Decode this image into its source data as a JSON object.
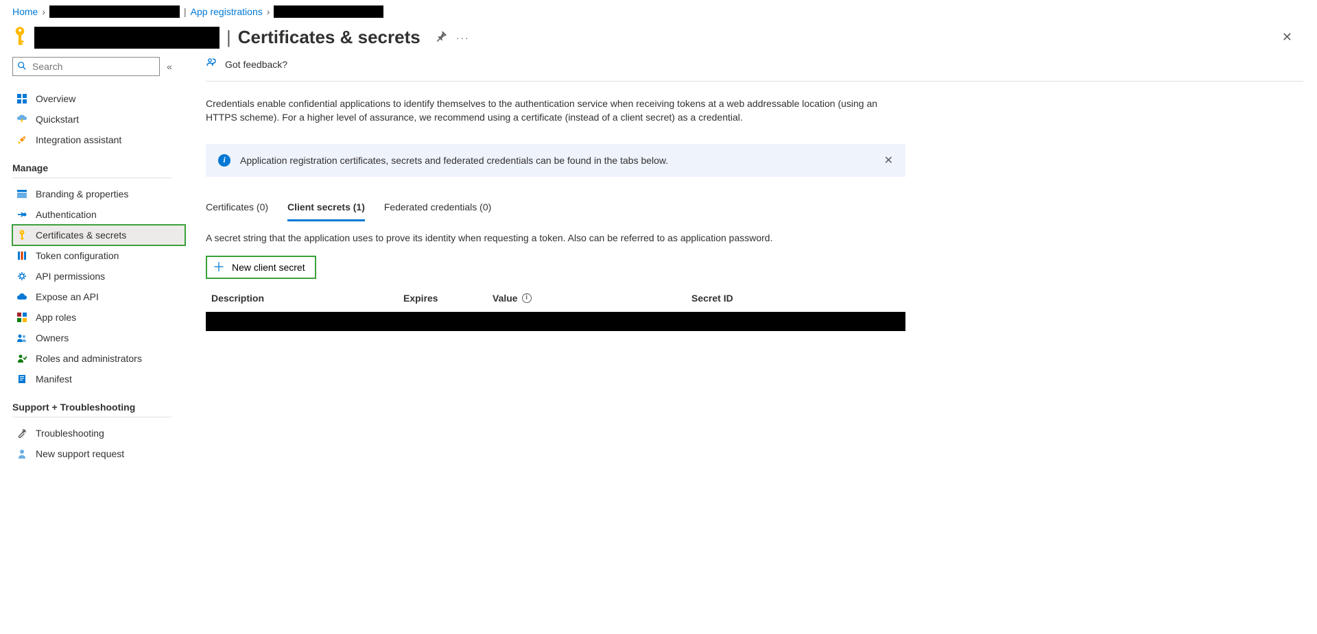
{
  "breadcrumb": {
    "home": "Home",
    "app_registrations": "App registrations"
  },
  "header": {
    "title_suffix": "Certificates & secrets"
  },
  "sidebar": {
    "search_placeholder": "Search",
    "sections": {
      "top": [
        {
          "label": "Overview"
        },
        {
          "label": "Quickstart"
        },
        {
          "label": "Integration assistant"
        }
      ],
      "manage_label": "Manage",
      "manage": [
        {
          "label": "Branding & properties"
        },
        {
          "label": "Authentication"
        },
        {
          "label": "Certificates & secrets"
        },
        {
          "label": "Token configuration"
        },
        {
          "label": "API permissions"
        },
        {
          "label": "Expose an API"
        },
        {
          "label": "App roles"
        },
        {
          "label": "Owners"
        },
        {
          "label": "Roles and administrators"
        },
        {
          "label": "Manifest"
        }
      ],
      "support_label": "Support + Troubleshooting",
      "support": [
        {
          "label": "Troubleshooting"
        },
        {
          "label": "New support request"
        }
      ]
    }
  },
  "main": {
    "feedback": "Got feedback?",
    "intro": "Credentials enable confidential applications to identify themselves to the authentication service when receiving tokens at a web addressable location (using an HTTPS scheme). For a higher level of assurance, we recommend using a certificate (instead of a client secret) as a credential.",
    "banner": "Application registration certificates, secrets and federated credentials can be found in the tabs below.",
    "tabs": [
      {
        "label": "Certificates (0)"
      },
      {
        "label": "Client secrets (1)"
      },
      {
        "label": "Federated credentials (0)"
      }
    ],
    "tab_desc": "A secret string that the application uses to prove its identity when requesting a token. Also can be referred to as application password.",
    "new_secret": "New client secret",
    "table": {
      "description": "Description",
      "expires": "Expires",
      "value": "Value",
      "secret_id": "Secret ID"
    }
  }
}
